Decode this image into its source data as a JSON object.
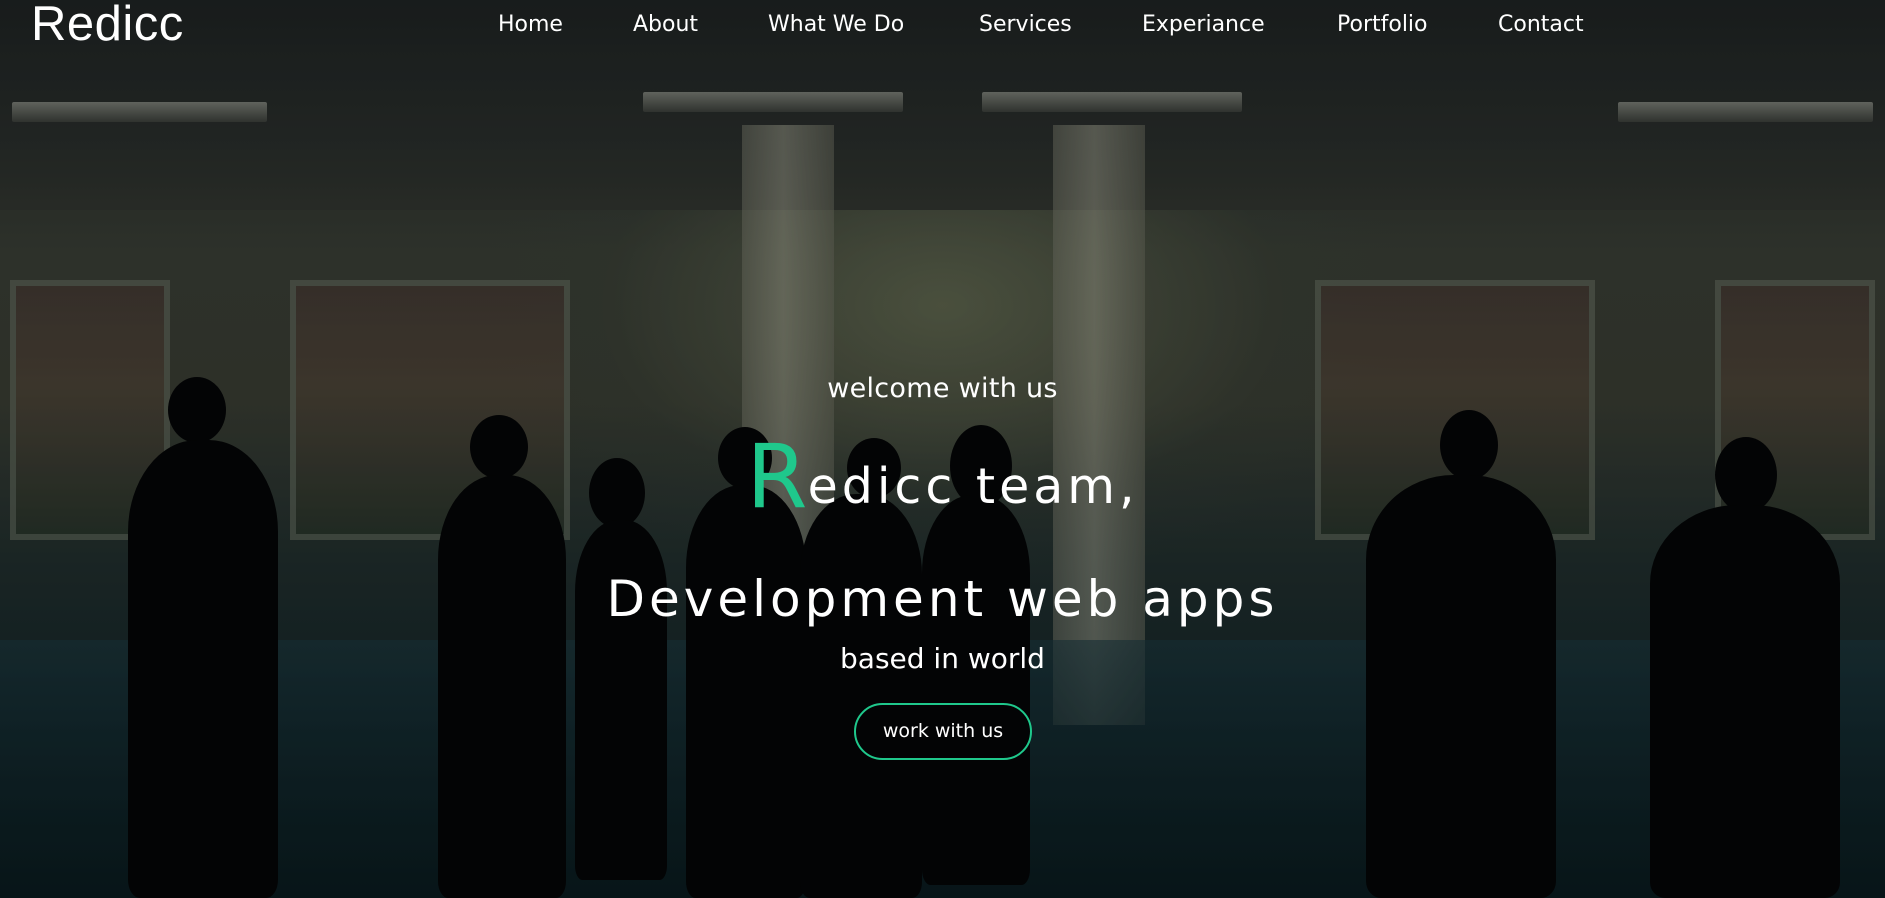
{
  "navbar": {
    "brand": "Redicc",
    "links": [
      {
        "label": "Home"
      },
      {
        "label": "About"
      },
      {
        "label": "What We Do"
      },
      {
        "label": "Services"
      },
      {
        "label": "Experiance"
      },
      {
        "label": "Portfolio"
      },
      {
        "label": "Contact"
      }
    ]
  },
  "hero": {
    "welcome": "welcome with us",
    "title_initial": "R",
    "title_rest": "edicc team,",
    "headline": "Development web apps",
    "subline": "based in world",
    "cta_label": "work with us",
    "accent_color": "#1fc88c",
    "background": "office-team-silhouettes"
  }
}
